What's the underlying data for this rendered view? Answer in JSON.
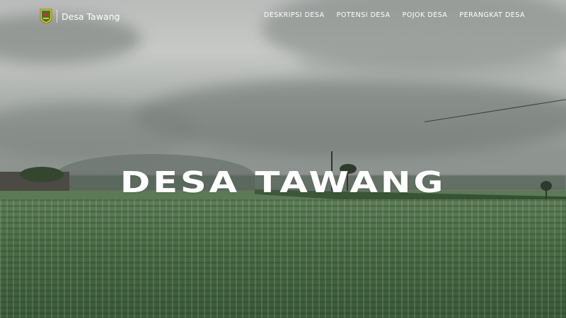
{
  "header": {
    "site_name": "Desa Tawang",
    "logo_icon": "regency-crest-icon",
    "nav": [
      {
        "label": "DESKRIPSI DESA"
      },
      {
        "label": "POTENSI DESA"
      },
      {
        "label": "POJOK DESA"
      },
      {
        "label": "PERANGKAT DESA"
      }
    ]
  },
  "hero": {
    "title": "DESA TAWANG",
    "background": "misty rice paddy field under overcast sky"
  },
  "colors": {
    "text": "#ffffff",
    "crest_yellow": "#e7c21a",
    "crest_green": "#2f7d3a",
    "crest_red": "#c8322d"
  }
}
